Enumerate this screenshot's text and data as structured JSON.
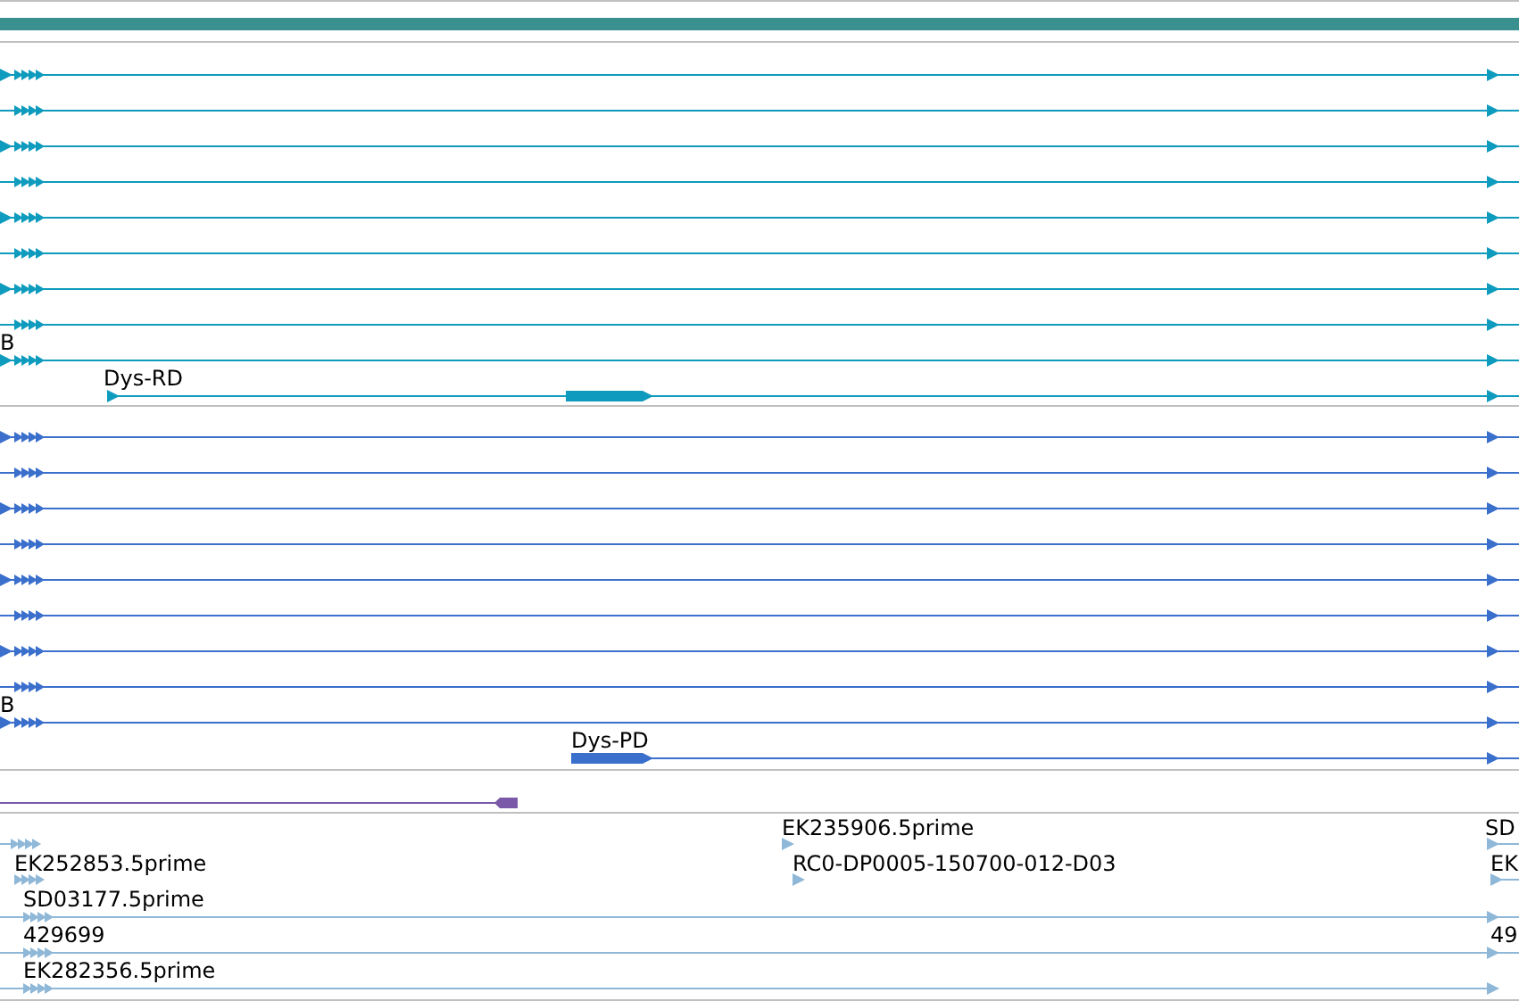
{
  "overview": {
    "kind": "region-bar"
  },
  "tracks": [
    {
      "kind": "transcripts",
      "color": "#0e9bbd",
      "rows": [
        {
          "kind": "cluster",
          "label": ""
        },
        {
          "kind": "cluster",
          "label": ""
        },
        {
          "kind": "cluster",
          "label": ""
        },
        {
          "kind": "cluster",
          "label": ""
        },
        {
          "kind": "cluster",
          "label": ""
        },
        {
          "kind": "cluster",
          "label": ""
        },
        {
          "kind": "cluster",
          "label": ""
        },
        {
          "kind": "cluster",
          "label": ""
        },
        {
          "kind": "cluster",
          "label": "B"
        },
        {
          "kind": "cds-start",
          "label": "Dys-RD"
        }
      ]
    },
    {
      "kind": "transcripts",
      "color": "#3a6fcc",
      "rows": [
        {
          "kind": "cluster",
          "label": ""
        },
        {
          "kind": "cluster",
          "label": ""
        },
        {
          "kind": "cluster",
          "label": ""
        },
        {
          "kind": "cluster",
          "label": ""
        },
        {
          "kind": "cluster",
          "label": ""
        },
        {
          "kind": "cluster",
          "label": ""
        },
        {
          "kind": "cluster",
          "label": ""
        },
        {
          "kind": "cluster",
          "label": ""
        },
        {
          "kind": "cluster",
          "label": "B"
        },
        {
          "kind": "cds-block",
          "label": "Dys-PD"
        }
      ]
    },
    {
      "kind": "reverse-feature",
      "color": "#7a5aa8"
    },
    {
      "kind": "ests",
      "color": "#8fb8d8",
      "labels": [
        "EK235906.5prime",
        "SD",
        "EK252853.5prime",
        "RC0-DP0005-150700-012-D03",
        "EK",
        "SD03177.5prime",
        "429699",
        "49",
        "EK282356.5prime"
      ]
    }
  ]
}
